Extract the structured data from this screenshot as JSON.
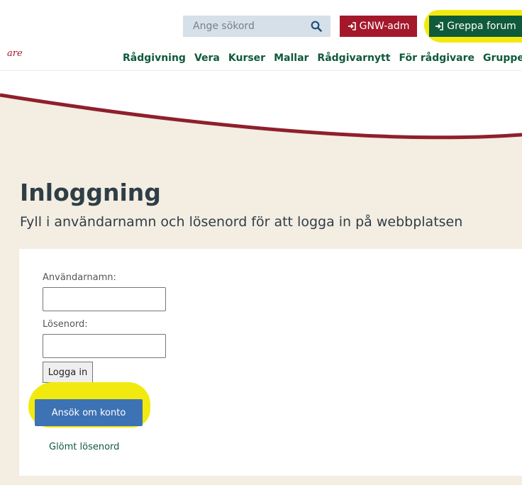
{
  "header": {
    "search": {
      "placeholder": "Ange sökord",
      "icon": "search-icon"
    },
    "gnw_button_label": "GNW-adm",
    "greppa_button_label": "Greppa forum",
    "login_icon": "sign-in-icon",
    "logo_text_fragment": "are",
    "colors": {
      "brand_red": "#a3182b",
      "brand_green": "#0f5a3a",
      "highlight_yellow": "#f2ea0f"
    }
  },
  "nav": {
    "items": [
      {
        "label": "Rådgivning"
      },
      {
        "label": "Vera"
      },
      {
        "label": "Kurser"
      },
      {
        "label": "Mallar"
      },
      {
        "label": "Rådgivarnytt"
      },
      {
        "label": "För rådgivare"
      },
      {
        "label": "Grupper"
      }
    ]
  },
  "page": {
    "title": "Inloggning",
    "subtitle": "Fyll i användarnamn och lösenord för att logga in på webbplatsen"
  },
  "form": {
    "username_label": "Användarnamn:",
    "username_value": "",
    "password_label": "Lösenord:",
    "password_value": "",
    "login_button_label": "Logga in",
    "apply_button_label": "Ansök om konto",
    "forgot_link_label": "Glömt lösenord",
    "colors": {
      "apply_button": "#3d72b4"
    }
  }
}
